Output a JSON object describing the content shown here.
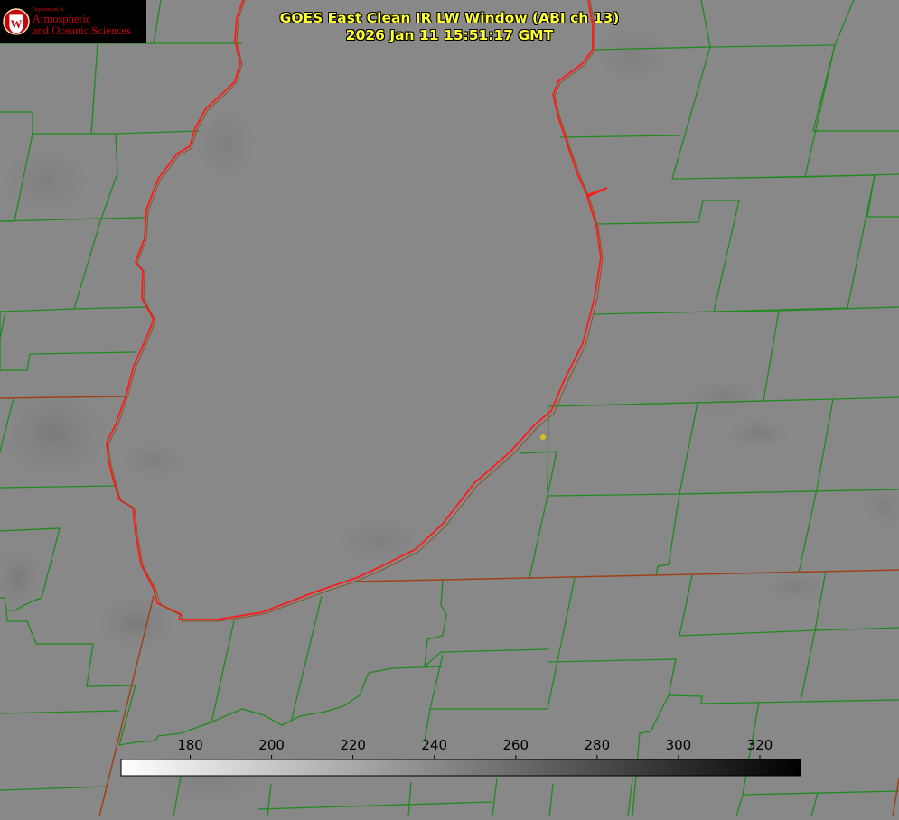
{
  "logo": {
    "dept_text": "Department of",
    "line1": "Atmospheric",
    "line2": "and Oceanic Sciences",
    "crest_icon": "uw-crest-icon"
  },
  "title": {
    "line1": "GOES East Clean IR LW Window (ABI ch 13)",
    "line2": "2026 Jan 11 15:51:17 GMT"
  },
  "colorbar": {
    "ticks": [
      180,
      200,
      220,
      240,
      260,
      280,
      300,
      320
    ],
    "range": [
      163,
      330
    ],
    "colors": {
      "low": "#ffffff",
      "high": "#000000"
    }
  },
  "colors": {
    "background": "#888888",
    "county_lines": "#1f8a1f",
    "state_lines": "#a04018",
    "coastline": "#ff1a1a",
    "title_text": "#ffff33",
    "marker": "#d4c21a"
  }
}
